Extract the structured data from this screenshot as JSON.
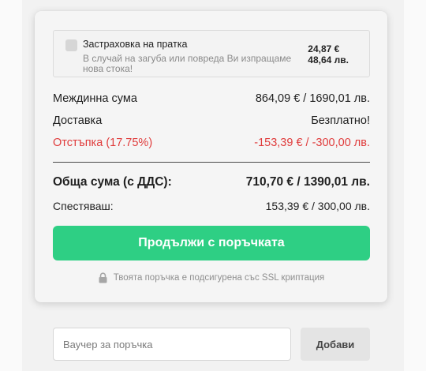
{
  "insurance": {
    "title": "Застраховка на пратка",
    "description": "В случай на загуба или повреда Ви изпращаме нова стока!",
    "price_eur": "24,87 €",
    "price_bgn": "48,64 лв.",
    "checked": false
  },
  "summary": {
    "subtotal_label": "Междинна сума",
    "subtotal_value": "864,09 € / 1690,01 лв.",
    "delivery_label": "Доставка",
    "delivery_value": "Безплатно!",
    "discount_label": "Отстъпка (17.75%)",
    "discount_value": "-153,39 € / -300,00 лв.",
    "total_label": "Обща сума (с ДДС):",
    "total_value": "710,70 € / 1390,01 лв.",
    "saved_label": "Спестяваш:",
    "saved_value": "153,39 € / 300,00 лв."
  },
  "cta": {
    "label": "Продължи с поръчката"
  },
  "security": {
    "text": "Твоята поръчка е подсигурена със SSL криптация",
    "icon": "lock-icon"
  },
  "voucher": {
    "placeholder": "Ваучер за поръчка",
    "value": "",
    "button_label": "Добави"
  },
  "colors": {
    "accent": "#2ecf84",
    "discount": "#e03c3c"
  }
}
